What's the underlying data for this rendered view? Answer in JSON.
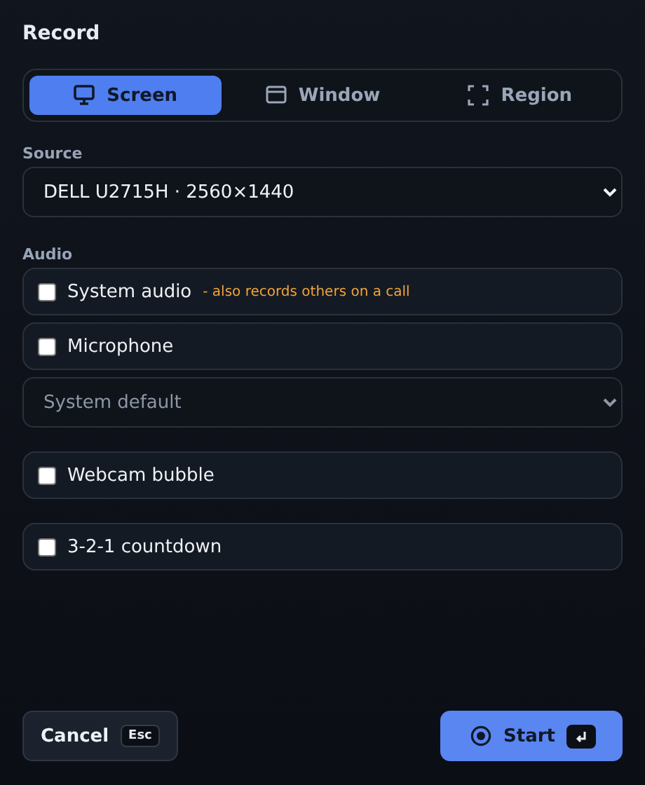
{
  "title": "Record",
  "modes": [
    {
      "label": "Screen",
      "kind": "screen",
      "selected": true
    },
    {
      "label": "Window",
      "kind": "window",
      "selected": false
    },
    {
      "label": "Region",
      "kind": "region",
      "selected": false
    }
  ],
  "source": {
    "label": "Source",
    "value": "DELL U2715H · 2560×1440"
  },
  "audio": {
    "label": "Audio",
    "items": [
      {
        "kind": "checkbox",
        "label": "System audio",
        "note": "- also records others on a call",
        "checked": false
      },
      {
        "kind": "checkbox",
        "label": "Microphone",
        "checked": false
      },
      {
        "kind": "select",
        "value": "System default"
      }
    ]
  },
  "options": [
    {
      "label": "Webcam bubble",
      "checked": false
    },
    {
      "label": "3-2-1 countdown",
      "checked": false
    }
  ],
  "cancel": {
    "label": "Cancel",
    "key": "Esc"
  },
  "start": {
    "label": "Start"
  }
}
